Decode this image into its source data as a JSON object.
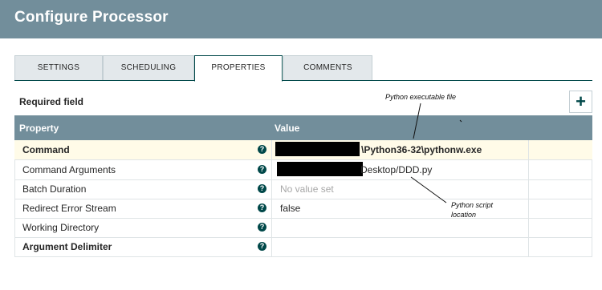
{
  "window": {
    "title": "Configure Processor"
  },
  "tabs": [
    {
      "label": "SETTINGS"
    },
    {
      "label": "SCHEDULING"
    },
    {
      "label": "PROPERTIES",
      "active": true
    },
    {
      "label": "COMMENTS"
    }
  ],
  "properties_panel": {
    "required_label": "Required field",
    "add_icon": "plus-icon",
    "columns": {
      "property": "Property",
      "value": "Value"
    },
    "rows": [
      {
        "name": "Command",
        "value": "\\Python36-32\\pythonw.exe",
        "required": true,
        "selected": true
      },
      {
        "name": "Command Arguments",
        "value": "Desktop/DDD.py",
        "required": false
      },
      {
        "name": "Batch Duration",
        "value": "No value set",
        "required": false
      },
      {
        "name": "Redirect Error Stream",
        "value": "false",
        "required": false
      },
      {
        "name": "Working Directory",
        "value": "",
        "required": false
      },
      {
        "name": "Argument Delimiter",
        "value": "",
        "required": true
      }
    ],
    "help_icon": "question-icon",
    "help_glyph": "?"
  },
  "annotations": {
    "executable": "Python executable file",
    "script_line1": "Python script",
    "script_line2": "location"
  },
  "colors": {
    "header": "#728e9b",
    "accent": "#004849",
    "selected_row": "#fffbe8"
  }
}
